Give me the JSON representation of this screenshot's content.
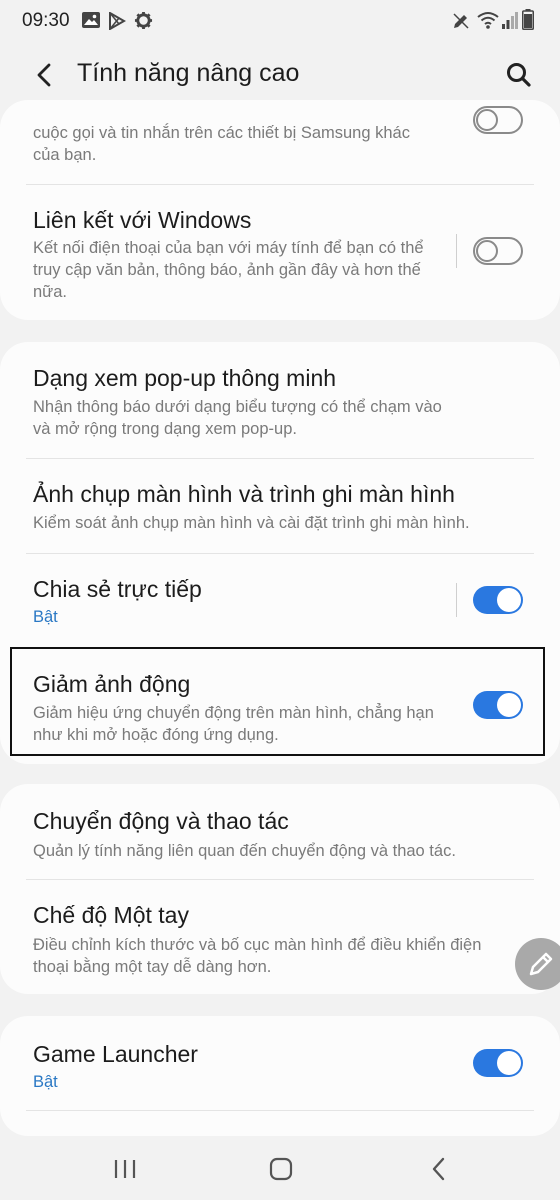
{
  "status_bar": {
    "time": "09:30",
    "left_icons": [
      "gallery-icon",
      "play-store-icon",
      "settings-gear-icon"
    ],
    "right_icons": [
      "edit-icon",
      "wifi-icon",
      "signal-icon",
      "battery-icon"
    ]
  },
  "header": {
    "title": "Tính năng nâng cao"
  },
  "card1": {
    "partial_desc_line1": "cuộc gọi và tin nhắn trên các thiết bị Samsung khác",
    "partial_desc_line2": "của bạn.",
    "item": {
      "title": "Liên kết với Windows",
      "description": "Kết nối điện thoại của bạn với máy tính để bạn có thể truy cập văn bản, thông báo, ảnh gần đây và hơn thế nữa.",
      "toggle_on": false
    }
  },
  "card2": {
    "items": [
      {
        "title": "Dạng xem pop-up thông minh",
        "description": "Nhận thông báo dưới dạng biểu tượng có thể chạm vào và mở rộng trong dạng xem pop-up."
      },
      {
        "title": "Ảnh chụp màn hình và trình ghi màn hình",
        "description": "Kiểm soát ảnh chụp màn hình và cài đặt trình ghi màn hình."
      },
      {
        "title": "Chia sẻ trực tiếp",
        "state": "Bật",
        "toggle_on": true
      },
      {
        "title": "Giảm ảnh động",
        "description": "Giảm hiệu ứng chuyển động trên màn hình, chẳng hạn như khi mở hoặc đóng ứng dụng.",
        "toggle_on": true
      }
    ]
  },
  "card3": {
    "items": [
      {
        "title": "Chuyển động và thao tác",
        "description": "Quản lý tính năng liên quan đến chuyển động và thao tác."
      },
      {
        "title": "Chế độ Một tay",
        "description": "Điều chỉnh kích thước và bố cục màn hình để điều khiển điện thoại bằng một tay dễ dàng hơn."
      }
    ]
  },
  "card4": {
    "items": [
      {
        "title": "Game Launcher",
        "state": "Bật",
        "toggle_on": true
      }
    ]
  },
  "colors": {
    "accent": "#2a78e0",
    "state_text": "#2a78c4",
    "background": "#f2f2f2",
    "card": "#fcfcfc"
  },
  "nav_bar": {
    "buttons": [
      "recents-icon",
      "home-icon",
      "back-icon"
    ]
  }
}
